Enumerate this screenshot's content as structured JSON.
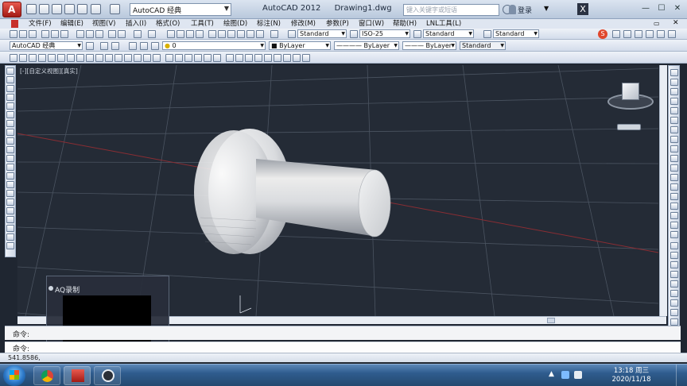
{
  "titlebar": {
    "workspace": "AutoCAD 经典",
    "app_name": "AutoCAD 2012",
    "document": "Drawing1.dwg",
    "search_placeholder": "键入关键字或短语",
    "signin": "登录"
  },
  "menu": [
    "文件(F)",
    "编辑(E)",
    "视图(V)",
    "插入(I)",
    "格式(O)",
    "工具(T)",
    "绘图(D)",
    "标注(N)",
    "修改(M)",
    "参数(P)",
    "窗口(W)",
    "帮助(H)",
    "LNL工具(L)"
  ],
  "toolbar": {
    "text_style": "Standard",
    "dim_style": "ISO-25",
    "table_style": "Standard",
    "multileader_style": "Standard",
    "workspace2": "AutoCAD 经典",
    "layer": "0",
    "color": "ByLayer",
    "linetype": "ByLayer",
    "lineweight": "ByLayer",
    "plot_style": "Standard"
  },
  "viewport": {
    "label": "[-][自定义视图][真实]"
  },
  "command": {
    "prompt1": "命令:",
    "prompt2": "命令:"
  },
  "status": {
    "coords": "541.8586,"
  },
  "popup": {
    "title": "AQ录制"
  },
  "taskbar": {
    "time": "13:18 周三",
    "date": "2020/11/18"
  },
  "colors": {
    "viewport_bg": "#242b36",
    "grid_line": "#5b6573",
    "axis_red": "#8a2d33",
    "chrome": "#dfe6f1"
  }
}
